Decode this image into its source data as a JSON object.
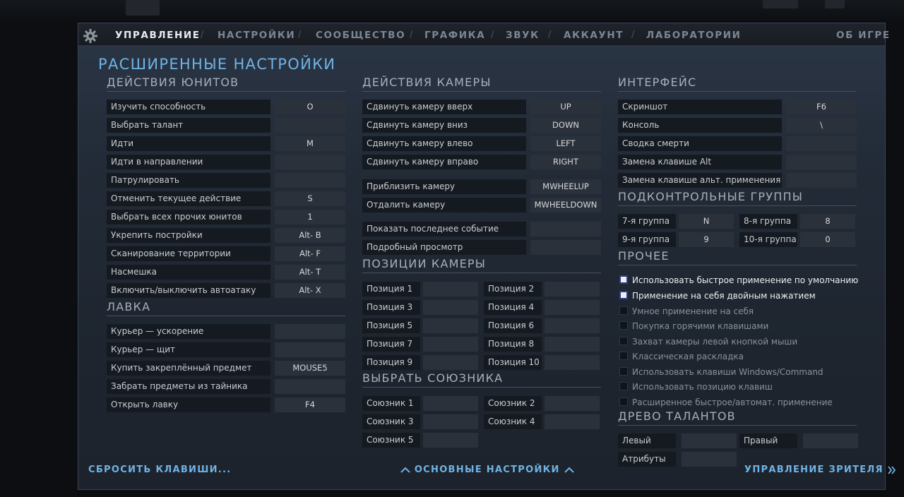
{
  "tabs": [
    {
      "label": "УПРАВЛЕНИЕ",
      "active": true
    },
    {
      "label": "НАСТРОЙКИ"
    },
    {
      "label": "СООБЩЕСТВО"
    },
    {
      "label": "ГРАФИКА"
    },
    {
      "label": "ЗВУК"
    },
    {
      "label": "АККАУНТ"
    },
    {
      "label": "ЛАБОРАТОРИИ"
    }
  ],
  "about_tab": "ОБ ИГРЕ",
  "tab_separator": "/",
  "page_title": "РАСШИРЕННЫЕ НАСТРОЙКИ",
  "unit_actions": {
    "title": "ДЕЙСТВИЯ ЮНИТОВ",
    "rows": [
      {
        "label": "Изучить способность",
        "key": "O"
      },
      {
        "label": "Выбрать талант",
        "key": ""
      },
      {
        "label": "Идти",
        "key": "M"
      },
      {
        "label": "Идти в направлении",
        "key": ""
      },
      {
        "label": "Патрулировать",
        "key": ""
      },
      {
        "label": "Отменить текущее действие",
        "key": "S"
      },
      {
        "label": "Выбрать всех прочих юнитов",
        "key": "1"
      },
      {
        "label": "Укрепить постройки",
        "key": "Alt- B"
      },
      {
        "label": "Сканирование территории",
        "key": "Alt- F"
      },
      {
        "label": "Насмешка",
        "key": "Alt- T"
      },
      {
        "label": "Включить/выключить автоатаку",
        "key": "Alt- X"
      }
    ]
  },
  "shop": {
    "title": "ЛАВКА",
    "rows": [
      {
        "label": "Курьер — ускорение",
        "key": ""
      },
      {
        "label": "Курьер — щит",
        "key": ""
      },
      {
        "label": "Купить закреплённый предмет",
        "key": "MOUSE5"
      },
      {
        "label": "Забрать предметы из тайника",
        "key": ""
      },
      {
        "label": "Открыть лавку",
        "key": "F4"
      }
    ]
  },
  "camera_actions": {
    "title": "ДЕЙСТВИЯ КАМЕРЫ",
    "rows": [
      {
        "label": "Сдвинуть камеру вверх",
        "key": "UP"
      },
      {
        "label": "Сдвинуть камеру вниз",
        "key": "DOWN"
      },
      {
        "label": "Сдвинуть камеру влево",
        "key": "LEFT"
      },
      {
        "label": "Сдвинуть камеру вправо",
        "key": "RIGHT"
      },
      {
        "label": "Приблизить камеру",
        "key": "MWHEELUP"
      },
      {
        "label": "Отдалить камеру",
        "key": "MWHEELDOWN"
      },
      {
        "label": "Показать последнее событие",
        "key": ""
      },
      {
        "label": "Подробный просмотр",
        "key": ""
      }
    ]
  },
  "camera_positions": {
    "title": "ПОЗИЦИИ КАМЕРЫ",
    "items": [
      {
        "label": "Позиция 1",
        "key": ""
      },
      {
        "label": "Позиция 2",
        "key": ""
      },
      {
        "label": "Позиция 3",
        "key": ""
      },
      {
        "label": "Позиция 4",
        "key": ""
      },
      {
        "label": "Позиция 5",
        "key": ""
      },
      {
        "label": "Позиция 6",
        "key": ""
      },
      {
        "label": "Позиция 7",
        "key": ""
      },
      {
        "label": "Позиция 8",
        "key": ""
      },
      {
        "label": "Позиция 9",
        "key": ""
      },
      {
        "label": "Позиция 10",
        "key": ""
      }
    ]
  },
  "select_ally": {
    "title": "ВЫБРАТЬ СОЮЗНИКА",
    "items": [
      {
        "label": "Союзник 1",
        "key": ""
      },
      {
        "label": "Союзник 2",
        "key": ""
      },
      {
        "label": "Союзник 3",
        "key": ""
      },
      {
        "label": "Союзник 4",
        "key": ""
      },
      {
        "label": "Союзник 5",
        "key": ""
      }
    ]
  },
  "interface": {
    "title": "ИНТЕРФЕЙС",
    "rows": [
      {
        "label": "Скриншот",
        "key": "F6"
      },
      {
        "label": "Консоль",
        "key": "\\"
      },
      {
        "label": "Сводка смерти",
        "key": ""
      },
      {
        "label": "Замена клавише Alt",
        "key": ""
      },
      {
        "label": "Замена клавише альт. применения",
        "key": ""
      }
    ]
  },
  "control_groups": {
    "title": "ПОДКОНТРОЛЬНЫЕ ГРУППЫ",
    "items": [
      {
        "label": "7-я группа",
        "key": "N"
      },
      {
        "label": "8-я группа",
        "key": "8"
      },
      {
        "label": "9-я группа",
        "key": "9"
      },
      {
        "label": "10-я группа",
        "key": "0"
      }
    ]
  },
  "other": {
    "title": "ПРОЧЕЕ",
    "options": [
      {
        "label": "Использовать быстрое применение по умолчанию",
        "checked": true
      },
      {
        "label": "Применение на себя двойным нажатием",
        "checked": true
      },
      {
        "label": "Умное применение на себя",
        "checked": false
      },
      {
        "label": "Покупка горячими клавишами",
        "checked": false
      },
      {
        "label": "Захват камеры левой кнопкой мыши",
        "checked": false
      },
      {
        "label": "Классическая раскладка",
        "checked": false
      },
      {
        "label": "Использовать клавиши Windows/Command",
        "checked": false
      },
      {
        "label": "Использовать позицию клавиш",
        "checked": false
      },
      {
        "label": "Расширенное быстрое/автомат. применение",
        "checked": false
      }
    ]
  },
  "talent_tree": {
    "title": "ДРЕВО ТАЛАНТОВ",
    "items": [
      {
        "label": "Левый",
        "key": ""
      },
      {
        "label": "Правый",
        "key": ""
      },
      {
        "label": "Атрибуты",
        "key": ""
      }
    ]
  },
  "footer": {
    "reset": "СБРОСИТЬ КЛАВИШИ...",
    "basic": "ОСНОВНЫЕ НАСТРОЙКИ",
    "spectator": "УПРАВЛЕНИЕ ЗРИТЕЛЯ"
  },
  "colors": {
    "accent": "#6fb3e6",
    "panel_bg": "#222b37",
    "label_bg": "#151a21",
    "key_bg": "#2a313b"
  },
  "icons": {
    "settings": "gear-icon",
    "arrow_up": "chevron-up-icon",
    "double_arrow": "double-chevron-right-icon"
  }
}
